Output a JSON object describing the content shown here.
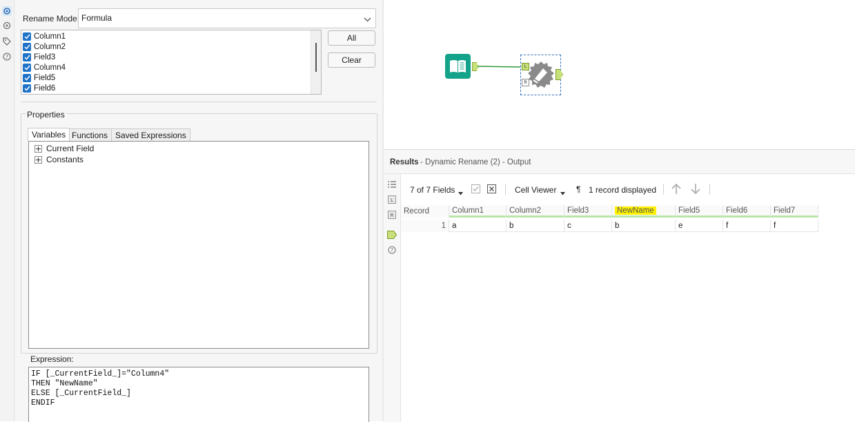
{
  "config": {
    "rename_mode_label": "Rename Mode:",
    "rename_mode_value": "Formula",
    "fields": [
      {
        "label": "Column1",
        "checked": true
      },
      {
        "label": "Column2",
        "checked": true
      },
      {
        "label": "Field3",
        "checked": true
      },
      {
        "label": "Column4",
        "checked": true
      },
      {
        "label": "Field5",
        "checked": true
      },
      {
        "label": "Field6",
        "checked": true
      }
    ],
    "all_button": "All",
    "clear_button": "Clear",
    "properties_label": "Properties",
    "tabs": [
      {
        "label": "Variables",
        "active": true
      },
      {
        "label": "Functions",
        "active": false
      },
      {
        "label": "Saved Expressions",
        "active": false
      }
    ],
    "tree": [
      {
        "label": "Current Field"
      },
      {
        "label": "Constants"
      }
    ],
    "expression_label": "Expression:",
    "expression_lines": [
      "IF [_CurrentField_]=\"Column4\"",
      "THEN \"NewName\"",
      "ELSE [_CurrentField_]",
      "ENDIF"
    ]
  },
  "canvas": {
    "input_tool_icon": "book-icon",
    "dynamic_rename_icon": "dynamic-rename-icon",
    "anchor_left": "L",
    "anchor_right": "R",
    "accent_green": "#12a38a"
  },
  "results": {
    "title": "Results",
    "subtitle": "- Dynamic Rename (2) - Output",
    "fields_selector": "7 of 7 Fields",
    "cell_viewer": "Cell Viewer",
    "pilcrow": "¶",
    "records_displayed": "1 record displayed",
    "columns": [
      "Record",
      "Column1",
      "Column2",
      "Field3",
      "NewName",
      "Field5",
      "Field6",
      "Field7"
    ],
    "highlighted_column": "NewName",
    "rows": [
      [
        "1",
        "a",
        "b",
        "c",
        "b",
        "e",
        "f",
        "f"
      ]
    ]
  }
}
